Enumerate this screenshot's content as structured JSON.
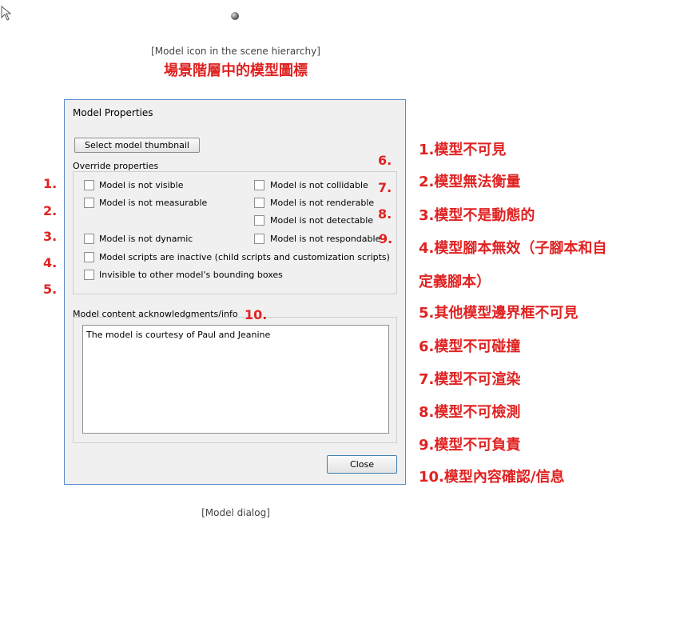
{
  "caption_top": "[Model icon in the scene hierarchy]",
  "title_cn": "場景階層中的模型圖標",
  "caption_bottom": "[Model dialog]",
  "dialog": {
    "title": "Model Properties",
    "thumbnail_button": "Select model thumbnail",
    "override_label": "Override properties",
    "checkboxes": {
      "not_visible": "Model is not visible",
      "not_measurable": "Model is not measurable",
      "not_dynamic": "Model is not dynamic",
      "scripts_inactive": "Model scripts are inactive (child scripts and customization scripts)",
      "invisible_bbox": "Invisible to other model's bounding boxes",
      "not_collidable": "Model is not collidable",
      "not_renderable": "Model is not renderable",
      "not_detectable": "Model is not detectable",
      "not_respondable": "Model is not respondable"
    },
    "content_label": "Model content acknowledgments/info",
    "content_text": "The model is courtesy of Paul and Jeanine",
    "close_button": "Close"
  },
  "markers": [
    "1.",
    "2.",
    "3.",
    "4.",
    "5.",
    "6.",
    "7.",
    "8.",
    "9.",
    "10."
  ],
  "legend": [
    "1.模型不可見",
    "2.模型無法衡量",
    "3.模型不是動態的",
    "4.模型腳本無效（子腳本和自",
    "定義腳本）",
    "5.其他模型邊界框不可見",
    "6.模型不可碰撞",
    "7.模型不可渲染",
    "8.模型不可檢測",
    "9.模型不可負責",
    "10.模型內容確認/信息"
  ]
}
